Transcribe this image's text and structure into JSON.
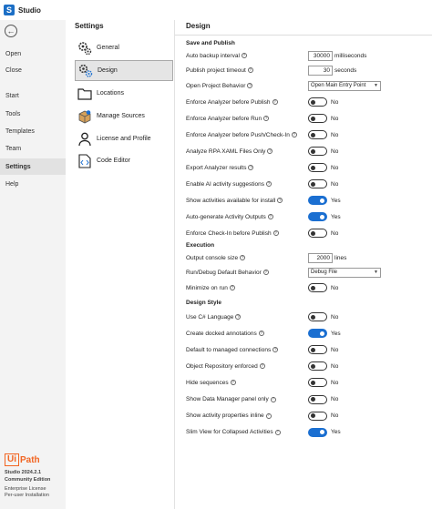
{
  "app": {
    "title": "Studio",
    "logo_letter": "S"
  },
  "leftnav": {
    "items": [
      {
        "label": "Open"
      },
      {
        "label": "Close"
      },
      {
        "label": "Start"
      },
      {
        "label": "Tools"
      },
      {
        "label": "Templates"
      },
      {
        "label": "Team"
      },
      {
        "label": "Settings",
        "active": true
      },
      {
        "label": "Help"
      }
    ],
    "logo": {
      "ui": "Ui",
      "path": "Path"
    },
    "version_lines": [
      "Studio 2024.2.1",
      "Community Edition",
      "Enterprise License",
      "Per-user Installation"
    ]
  },
  "settings": {
    "title": "Settings",
    "categories": [
      {
        "label": "General",
        "icon": "gears-icon"
      },
      {
        "label": "Design",
        "icon": "design-gears-icon",
        "active": true
      },
      {
        "label": "Locations",
        "icon": "folder-icon"
      },
      {
        "label": "Manage Sources",
        "icon": "package-icon"
      },
      {
        "label": "License and Profile",
        "icon": "person-icon"
      },
      {
        "label": "Code Editor",
        "icon": "code-file-icon"
      }
    ]
  },
  "design": {
    "title": "Design",
    "sections": {
      "save_publish": "Save and Publish",
      "execution": "Execution",
      "design_style": "Design Style"
    },
    "auto_backup": {
      "label": "Auto backup interval",
      "value": "30000",
      "unit": "milliseconds"
    },
    "publish_timeout": {
      "label": "Publish project timeout",
      "value": "30",
      "unit": "seconds"
    },
    "open_behavior": {
      "label": "Open Project Behavior",
      "value": "Open Main Entry Point"
    },
    "save_toggles": [
      {
        "label": "Enforce Analyzer before Publish",
        "state": "No",
        "on": false
      },
      {
        "label": "Enforce Analyzer before Run",
        "state": "No",
        "on": false
      },
      {
        "label": "Enforce Analyzer before Push/Check-In",
        "state": "No",
        "on": false
      },
      {
        "label": "Analyze RPA XAML Files Only",
        "state": "No",
        "on": false
      },
      {
        "label": "Export Analyzer results",
        "state": "No",
        "on": false
      },
      {
        "label": "Enable AI activity suggestions",
        "state": "No",
        "on": false
      },
      {
        "label": "Show activities available for install",
        "state": "Yes",
        "on": true
      },
      {
        "label": "Auto-generate Activity Outputs",
        "state": "Yes",
        "on": true
      },
      {
        "label": "Enforce Check-In before Publish",
        "state": "No",
        "on": false
      }
    ],
    "output_console": {
      "label": "Output console size",
      "value": "2000",
      "unit": "lines"
    },
    "run_debug": {
      "label": "Run/Debug Default Behavior",
      "value": "Debug File"
    },
    "minimize": {
      "label": "Minimize on run",
      "state": "No",
      "on": false
    },
    "style_toggles": [
      {
        "label": "Use C# Language",
        "state": "No",
        "on": false
      },
      {
        "label": "Create docked annotations",
        "state": "Yes",
        "on": true
      },
      {
        "label": "Default to managed connections",
        "state": "No",
        "on": false
      },
      {
        "label": "Object Repository enforced",
        "state": "No",
        "on": false
      },
      {
        "label": "Hide sequences",
        "state": "No",
        "on": false
      },
      {
        "label": "Show Data Manager panel only",
        "state": "No",
        "on": false
      },
      {
        "label": "Show activity properties inline",
        "state": "No",
        "on": false
      },
      {
        "label": "Slim View for Collapsed Activities",
        "state": "Yes",
        "on": true
      }
    ]
  },
  "colors": {
    "accent": "#1b6fd1",
    "brand": "#f26522"
  }
}
